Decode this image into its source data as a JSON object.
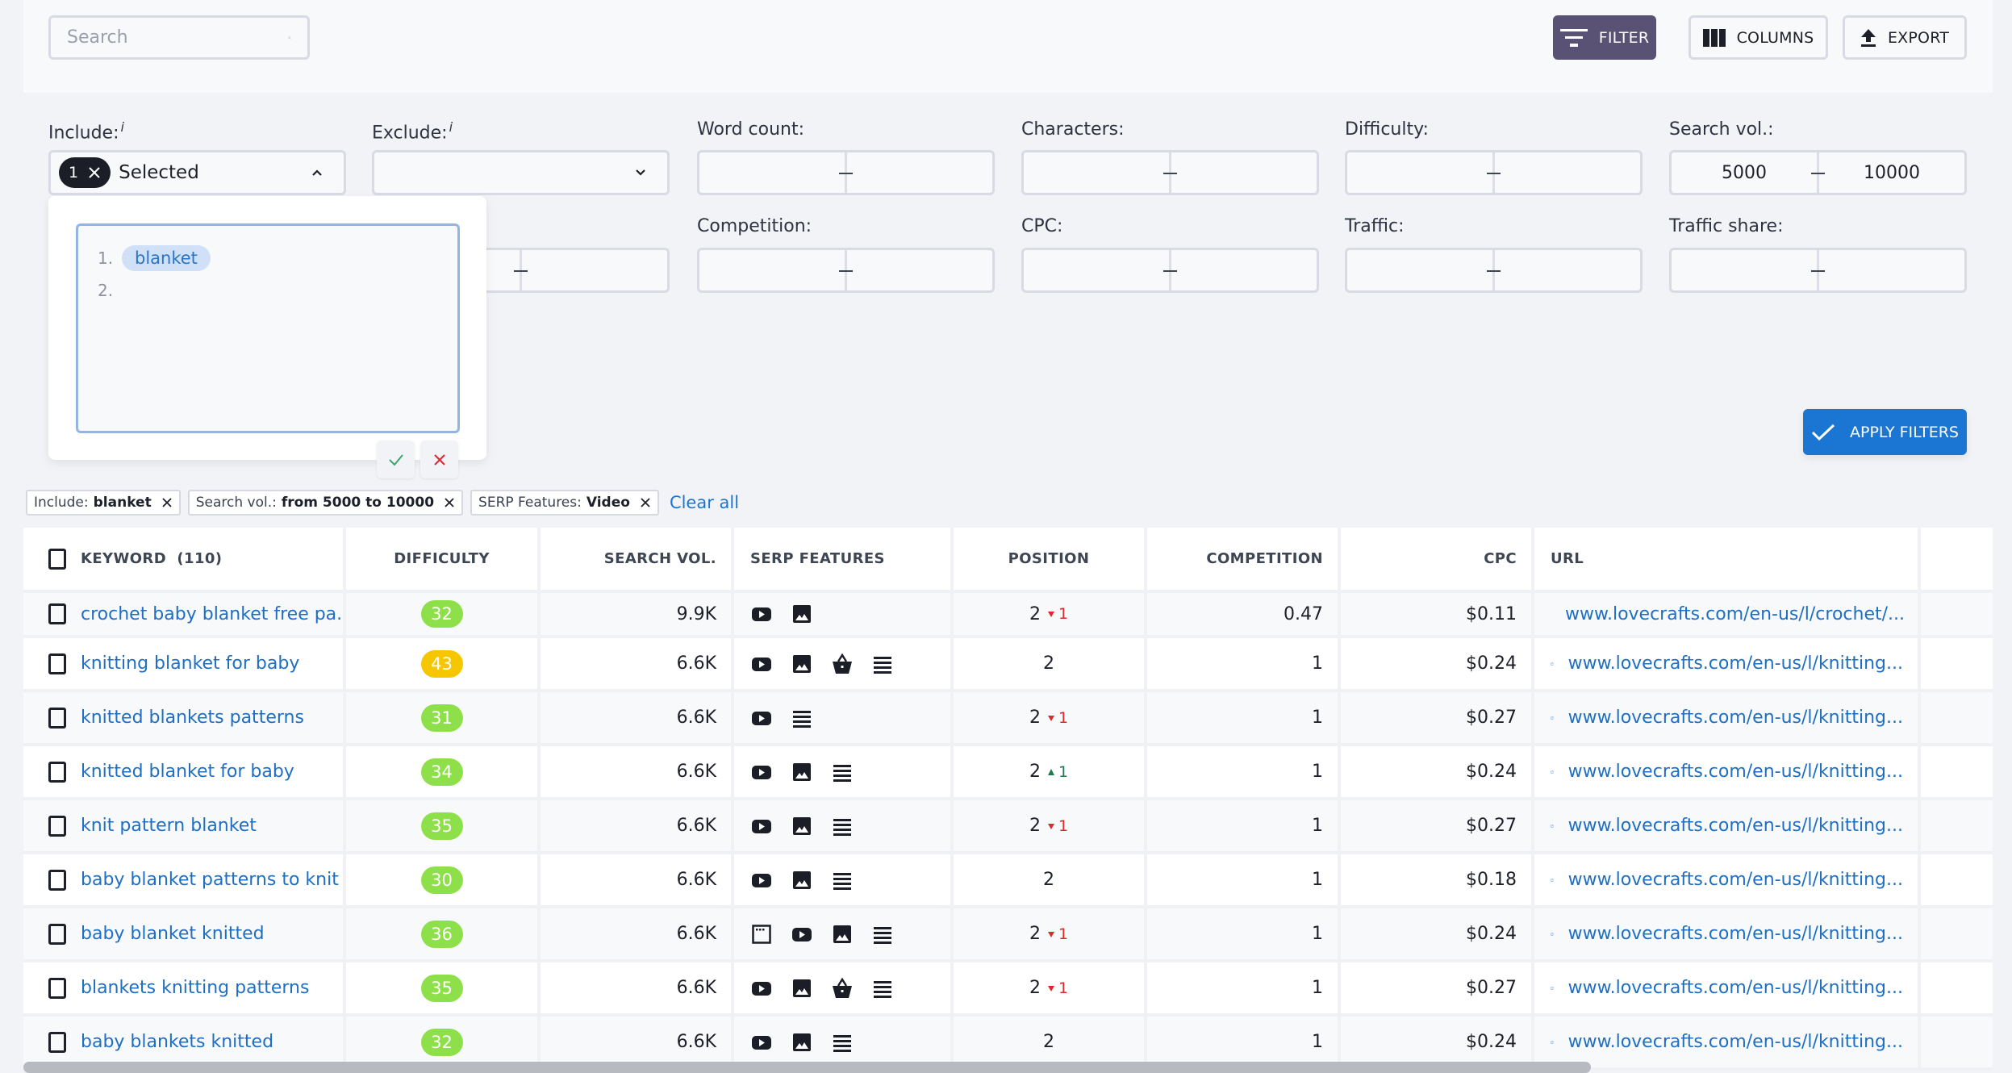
{
  "toolbar": {
    "search_placeholder": "Search",
    "filter_label": "FILTER",
    "columns_label": "COLUMNS",
    "export_label": "EXPORT"
  },
  "filters": {
    "include": {
      "label": "Include:",
      "info": "i",
      "count": "1",
      "value_text": "Selected"
    },
    "exclude": {
      "label": "Exclude:",
      "info": "i",
      "value_text": ""
    },
    "word_count": {
      "label": "Word count:",
      "from": "",
      "to": ""
    },
    "characters": {
      "label": "Characters:",
      "from": "",
      "to": ""
    },
    "difficulty": {
      "label": "Difficulty:",
      "from": "",
      "to": ""
    },
    "search_vol": {
      "label": "Search vol.:",
      "from": "5000",
      "to": "10000"
    },
    "hidden_range": {
      "from": "",
      "to": ""
    },
    "competition": {
      "label": "Competition:",
      "from": "",
      "to": ""
    },
    "cpc": {
      "label": "CPC:",
      "from": "",
      "to": ""
    },
    "traffic": {
      "label": "Traffic:",
      "from": "",
      "to": ""
    },
    "traffic_share": {
      "label": "Traffic share:",
      "from": "",
      "to": ""
    },
    "apply_label": "APPLY FILTERS"
  },
  "include_editor": {
    "lines": [
      {
        "num": "1.",
        "token": "blanket"
      },
      {
        "num": "2.",
        "token": ""
      }
    ]
  },
  "active_chips": [
    {
      "key": "Include:",
      "value": "blanket"
    },
    {
      "key": "Search vol.:",
      "value": "from 5000 to 10000"
    },
    {
      "key": "SERP Features:",
      "value": "Video"
    }
  ],
  "clear_all_label": "Clear all",
  "table": {
    "headers": {
      "keyword": "KEYWORD",
      "keyword_count": "(110)",
      "difficulty": "DIFFICULTY",
      "search_vol": "SEARCH VOL.",
      "serp_features": "SERP FEATURES",
      "position": "POSITION",
      "competition": "COMPETITION",
      "cpc": "CPC",
      "url": "URL"
    },
    "rows": [
      {
        "keyword": "crochet baby blanket free pa...",
        "difficulty": "32",
        "diff_color": "#8ee04a",
        "search_vol": "9.9K",
        "serp": [
          "video",
          "image"
        ],
        "position": "2",
        "delta_dir": "down",
        "delta": "1",
        "competition": "0.47",
        "cpc": "$0.11",
        "url": "www.lovecrafts.com/en-us/l/crochet/..."
      },
      {
        "keyword": "knitting blanket for baby",
        "difficulty": "43",
        "diff_color": "#f6c700",
        "search_vol": "6.6K",
        "serp": [
          "video",
          "image",
          "shopping",
          "list"
        ],
        "position": "2",
        "delta_dir": "",
        "delta": "",
        "competition": "1",
        "cpc": "$0.24",
        "url": "www.lovecrafts.com/en-us/l/knitting..."
      },
      {
        "keyword": "knitted blankets patterns",
        "difficulty": "31",
        "diff_color": "#8ee04a",
        "search_vol": "6.6K",
        "serp": [
          "video",
          "list"
        ],
        "position": "2",
        "delta_dir": "down",
        "delta": "1",
        "competition": "1",
        "cpc": "$0.27",
        "url": "www.lovecrafts.com/en-us/l/knitting..."
      },
      {
        "keyword": "knitted blanket for baby",
        "difficulty": "34",
        "diff_color": "#8ee04a",
        "search_vol": "6.6K",
        "serp": [
          "video",
          "image",
          "list"
        ],
        "position": "2",
        "delta_dir": "up",
        "delta": "1",
        "competition": "1",
        "cpc": "$0.24",
        "url": "www.lovecrafts.com/en-us/l/knitting..."
      },
      {
        "keyword": "knit pattern blanket",
        "difficulty": "35",
        "diff_color": "#8ee04a",
        "search_vol": "6.6K",
        "serp": [
          "video",
          "image",
          "list"
        ],
        "position": "2",
        "delta_dir": "down",
        "delta": "1",
        "competition": "1",
        "cpc": "$0.27",
        "url": "www.lovecrafts.com/en-us/l/knitting..."
      },
      {
        "keyword": "baby blanket patterns to knit",
        "difficulty": "30",
        "diff_color": "#8ee04a",
        "search_vol": "6.6K",
        "serp": [
          "video",
          "image",
          "list"
        ],
        "position": "2",
        "delta_dir": "",
        "delta": "",
        "competition": "1",
        "cpc": "$0.18",
        "url": "www.lovecrafts.com/en-us/l/knitting..."
      },
      {
        "keyword": "baby blanket knitted",
        "difficulty": "36",
        "diff_color": "#8ee04a",
        "search_vol": "6.6K",
        "serp": [
          "window",
          "video",
          "image",
          "list"
        ],
        "position": "2",
        "delta_dir": "down",
        "delta": "1",
        "competition": "1",
        "cpc": "$0.24",
        "url": "www.lovecrafts.com/en-us/l/knitting..."
      },
      {
        "keyword": "blankets knitting patterns",
        "difficulty": "35",
        "diff_color": "#8ee04a",
        "search_vol": "6.6K",
        "serp": [
          "video",
          "image",
          "shopping",
          "list"
        ],
        "position": "2",
        "delta_dir": "down",
        "delta": "1",
        "competition": "1",
        "cpc": "$0.27",
        "url": "www.lovecrafts.com/en-us/l/knitting..."
      },
      {
        "keyword": "baby blankets knitted",
        "difficulty": "32",
        "diff_color": "#8ee04a",
        "search_vol": "6.6K",
        "serp": [
          "video",
          "image",
          "list"
        ],
        "position": "2",
        "delta_dir": "",
        "delta": "",
        "competition": "1",
        "cpc": "$0.24",
        "url": "www.lovecrafts.com/en-us/l/knitting..."
      }
    ]
  },
  "colors": {
    "filter_button": "#5a5275",
    "apply_button": "#1b76d3",
    "link": "#1e6fc4",
    "delta_down": "#d92b2b",
    "delta_up": "#1f7a4d",
    "confirm": "#3aa86b",
    "cancel": "#e0262f"
  }
}
